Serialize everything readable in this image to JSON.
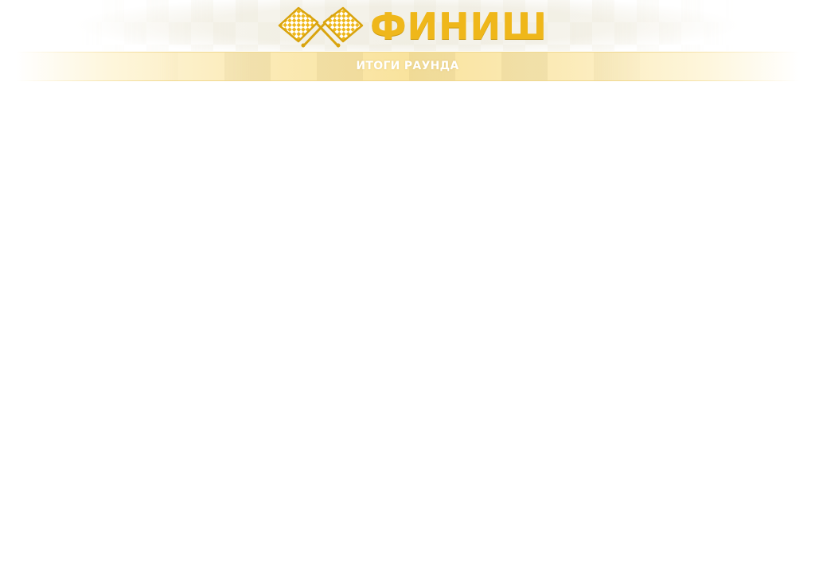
{
  "header": {
    "logo_text": "ФИНИШ",
    "logo_icon": "checkered-flags-icon"
  },
  "banner": {
    "title": "ИТОГИ РАУНДА"
  },
  "colors": {
    "accent": "#efb71a",
    "banner_gold": "#f8de8c",
    "background": "#ffffff"
  }
}
